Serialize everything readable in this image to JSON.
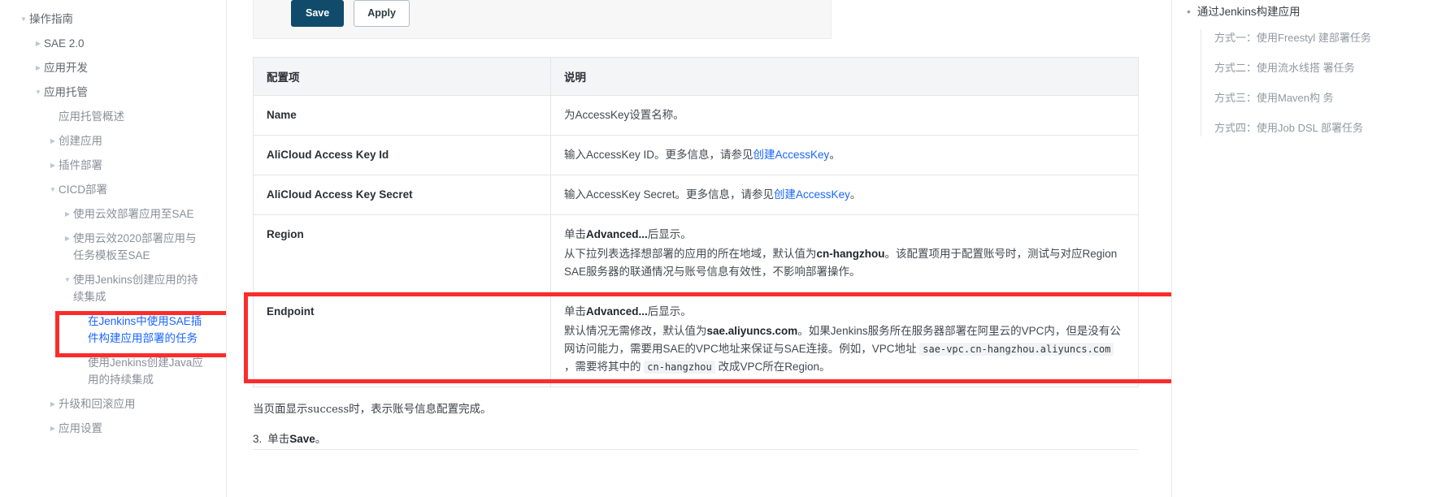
{
  "left_nav": [
    {
      "label": "操作指南",
      "level": 0,
      "caret": "down",
      "tone": "dark"
    },
    {
      "label": "SAE 2.0",
      "level": 1,
      "caret": "right",
      "tone": "dark"
    },
    {
      "label": "应用开发",
      "level": 1,
      "caret": "right",
      "tone": "dark"
    },
    {
      "label": "应用托管",
      "level": 1,
      "caret": "down",
      "tone": "dark"
    },
    {
      "label": "应用托管概述",
      "level": 2,
      "caret": "none",
      "tone": "gray"
    },
    {
      "label": "创建应用",
      "level": 2,
      "caret": "right",
      "tone": "gray"
    },
    {
      "label": "插件部署",
      "level": 2,
      "caret": "right",
      "tone": "gray"
    },
    {
      "label": "CICD部署",
      "level": 2,
      "caret": "down",
      "tone": "gray"
    },
    {
      "label": "使用云效部署应用至SAE",
      "level": 3,
      "caret": "right",
      "tone": "gray"
    },
    {
      "label": "使用云效2020部署应用与任务模板至SAE",
      "level": 3,
      "caret": "right",
      "tone": "gray"
    },
    {
      "label": "使用Jenkins创建应用的持续集成",
      "level": 3,
      "caret": "down",
      "tone": "gray"
    },
    {
      "label": "在Jenkins中使用SAE插件构建应用部署的任务",
      "level": 4,
      "caret": "none",
      "tone": "active"
    },
    {
      "label": "使用Jenkins创建Java应用的持续集成",
      "level": 4,
      "caret": "none",
      "tone": "gray"
    },
    {
      "label": "升级和回滚应用",
      "level": 2,
      "caret": "right",
      "tone": "gray"
    },
    {
      "label": "应用设置",
      "level": 2,
      "caret": "right",
      "tone": "gray"
    }
  ],
  "form_panel": {
    "save_label": "Save",
    "apply_label": "Apply"
  },
  "table": {
    "headers": [
      "配置项",
      "说明"
    ],
    "rows": [
      {
        "key": "Name",
        "lines": [
          [
            {
              "t": "为AccessKey设置名称。",
              "s": "n"
            }
          ]
        ]
      },
      {
        "key": "AliCloud Access Key Id",
        "lines": [
          [
            {
              "t": "输入AccessKey ID。更多信息，请参见",
              "s": "n"
            },
            {
              "t": "创建AccessKey",
              "s": "link"
            },
            {
              "t": "。",
              "s": "n"
            }
          ]
        ]
      },
      {
        "key": "AliCloud Access Key Secret",
        "lines": [
          [
            {
              "t": "输入AccessKey Secret。更多信息，请参见",
              "s": "n"
            },
            {
              "t": "创建AccessKey",
              "s": "link"
            },
            {
              "t": "。",
              "s": "n"
            }
          ]
        ]
      },
      {
        "key": "Region",
        "lines": [
          [
            {
              "t": "单击",
              "s": "n"
            },
            {
              "t": "Advanced...",
              "s": "b"
            },
            {
              "t": "后显示。",
              "s": "n"
            }
          ],
          [
            {
              "t": "从下拉列表选择想部署的应用的所在地域，默认值为",
              "s": "n"
            },
            {
              "t": "cn-hangzhou",
              "s": "b"
            },
            {
              "t": "。该配置项用于配置账号时，测试与对应Region SAE服务器的联通情况与账号信息有效性，不影响部署操作。",
              "s": "n"
            }
          ]
        ]
      },
      {
        "key": "Endpoint",
        "highlighted": true,
        "lines": [
          [
            {
              "t": "单击",
              "s": "n"
            },
            {
              "t": "Advanced...",
              "s": "b"
            },
            {
              "t": "后显示。",
              "s": "n"
            }
          ],
          [
            {
              "t": "默认情况无需修改，默认值为",
              "s": "n"
            },
            {
              "t": "sae.aliyuncs.com",
              "s": "b"
            },
            {
              "t": "。如果Jenkins服务所在服务器部署在阿里云的VPC内，但是没有公网访问能力，需要用SAE的VPC地址来保证与SAE连接。例如，VPC地址 ",
              "s": "n"
            },
            {
              "t": "sae-vpc.cn-hangzhou.aliyuncs.com",
              "s": "mono"
            },
            {
              "t": " ，需要将其中的 ",
              "s": "n"
            },
            {
              "t": "cn-hangzhou",
              "s": "mono"
            },
            {
              "t": " 改成VPC所在Region。",
              "s": "n"
            }
          ]
        ]
      }
    ]
  },
  "below_table": {
    "success_prefix": "当页面显示",
    "success_code": "success",
    "success_suffix": "时，表示账号信息配置完成。",
    "step_number": "3.",
    "step_prefix": "单击",
    "step_bold": "Save",
    "step_suffix": "。"
  },
  "right_toc": {
    "top_item": "通过Jenkins构建应用",
    "children": [
      "方式一：使用Freestyl 建部署任务",
      "方式二：使用流水线搭 署任务",
      "方式三：使用Maven构 务",
      "方式四：使用Job DSL 部署任务"
    ]
  },
  "colors": {
    "accent_link": "#1966ff",
    "highlight_red": "#fb2c2c",
    "save_button": "#114b6b"
  }
}
